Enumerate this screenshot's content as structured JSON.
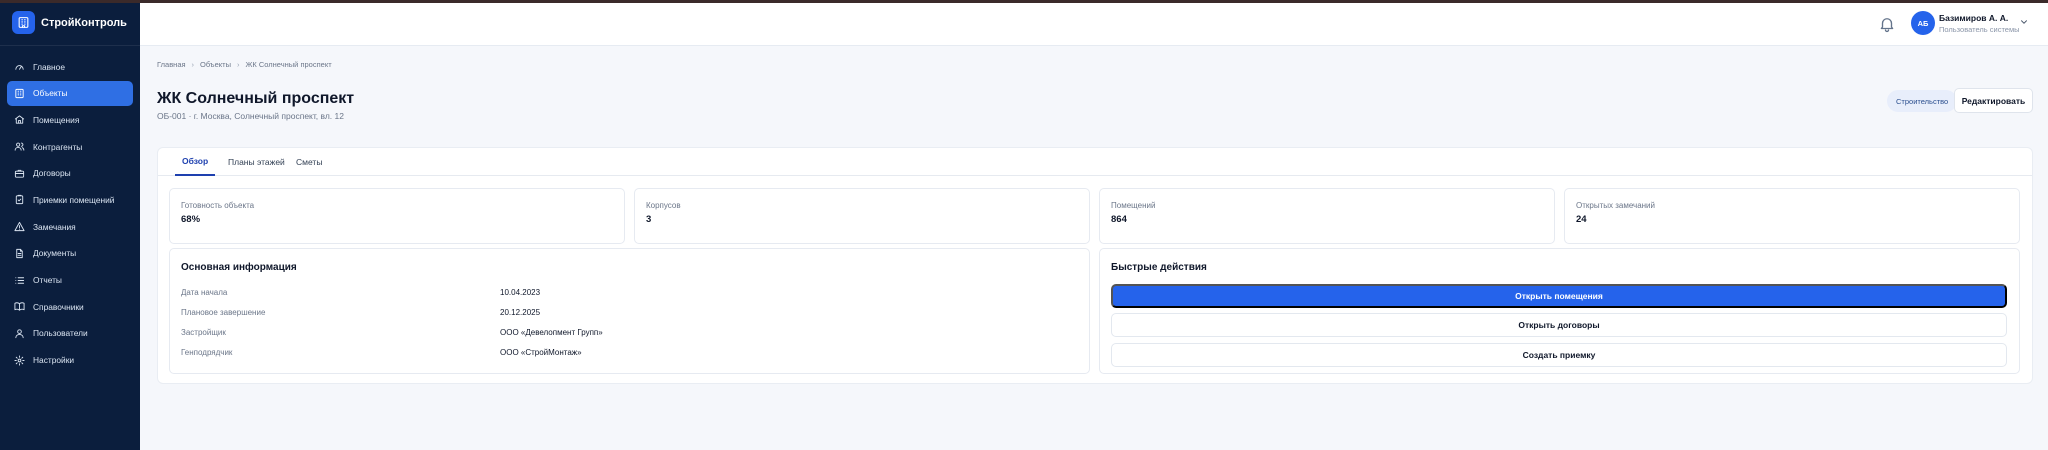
{
  "app": {
    "name": "СтройКонтроль"
  },
  "sidebar": {
    "items": [
      {
        "label": "Главное",
        "icon": "gauge-icon",
        "active": false
      },
      {
        "label": "Объекты",
        "icon": "building-icon",
        "active": true
      },
      {
        "label": "Помещения",
        "icon": "home-icon",
        "active": false
      },
      {
        "label": "Контрагенты",
        "icon": "users-icon",
        "active": false
      },
      {
        "label": "Договоры",
        "icon": "briefcase-icon",
        "active": false
      },
      {
        "label": "Приемки помещений",
        "icon": "clipboard-check-icon",
        "active": false
      },
      {
        "label": "Замечания",
        "icon": "alert-triangle-icon",
        "active": false
      },
      {
        "label": "Документы",
        "icon": "file-icon",
        "active": false
      },
      {
        "label": "Отчеты",
        "icon": "list-icon",
        "active": false
      },
      {
        "label": "Справочники",
        "icon": "book-icon",
        "active": false
      },
      {
        "label": "Пользователи",
        "icon": "user-icon",
        "active": false
      },
      {
        "label": "Настройки",
        "icon": "gear-icon",
        "active": false
      }
    ]
  },
  "header": {
    "user": {
      "initials": "АБ",
      "name": "Базимиров А. А.",
      "role": "Пользователь системы"
    }
  },
  "breadcrumb": [
    "Главная",
    "Объекты",
    "ЖК Солнечный проспект"
  ],
  "page": {
    "title": "ЖК Солнечный проспект",
    "subtitle": "ОБ-001 · г. Москва, Солнечный проспект, вл. 12",
    "status": "Строительство",
    "edit_label": "Редактировать"
  },
  "tabs": [
    {
      "label": "Обзор",
      "active": true
    },
    {
      "label": "Планы этажей",
      "active": false
    },
    {
      "label": "Сметы",
      "active": false
    }
  ],
  "stats": [
    {
      "label": "Готовность объекта",
      "value": "68%"
    },
    {
      "label": "Корпусов",
      "value": "3"
    },
    {
      "label": "Помещений",
      "value": "864"
    },
    {
      "label": "Открытых замечаний",
      "value": "24"
    }
  ],
  "info": {
    "title": "Основная информация",
    "rows": [
      {
        "label": "Дата начала",
        "value": "10.04.2023"
      },
      {
        "label": "Плановое завершение",
        "value": "20.12.2025"
      },
      {
        "label": "Застройщик",
        "value": "ООО «Девелопмент Групп»"
      },
      {
        "label": "Генподрядчик",
        "value": "ООО «СтройМонтаж»"
      }
    ]
  },
  "quick_actions": {
    "title": "Быстрые действия",
    "buttons": [
      {
        "label": "Открыть помещения",
        "style": "primary"
      },
      {
        "label": "Открыть договоры",
        "style": "outline"
      },
      {
        "label": "Создать приемку",
        "style": "outline"
      }
    ]
  },
  "colors": {
    "sidebar": "#0b1e3d",
    "accent": "#2563eb",
    "active_nav": "#2f6fe4",
    "background": "#f5f7fb"
  }
}
